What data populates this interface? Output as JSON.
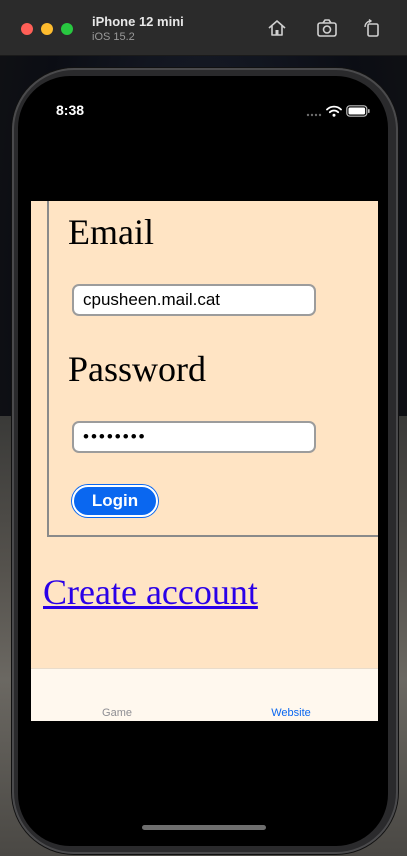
{
  "simulator": {
    "device_name": "iPhone 12 mini",
    "os_version": "iOS 15.2",
    "icons": [
      "home-icon",
      "screenshot-icon",
      "rotate-icon"
    ]
  },
  "status_bar": {
    "time": "8:38",
    "icons": [
      "cellular-icon",
      "wifi-icon",
      "battery-icon"
    ]
  },
  "login_form": {
    "email_label": "Email",
    "email_value": "cpusheen.mail.cat",
    "password_label": "Password",
    "password_value": "••••••••",
    "login_button": "Login"
  },
  "create_account_link": "Create account",
  "tab_bar": {
    "tabs": [
      {
        "label": "Game",
        "selected": false
      },
      {
        "label": "Website",
        "selected": true
      }
    ]
  },
  "colors": {
    "content_background": "#ffe4c4",
    "accent": "#0a67f0",
    "link": "#2a00e8"
  }
}
